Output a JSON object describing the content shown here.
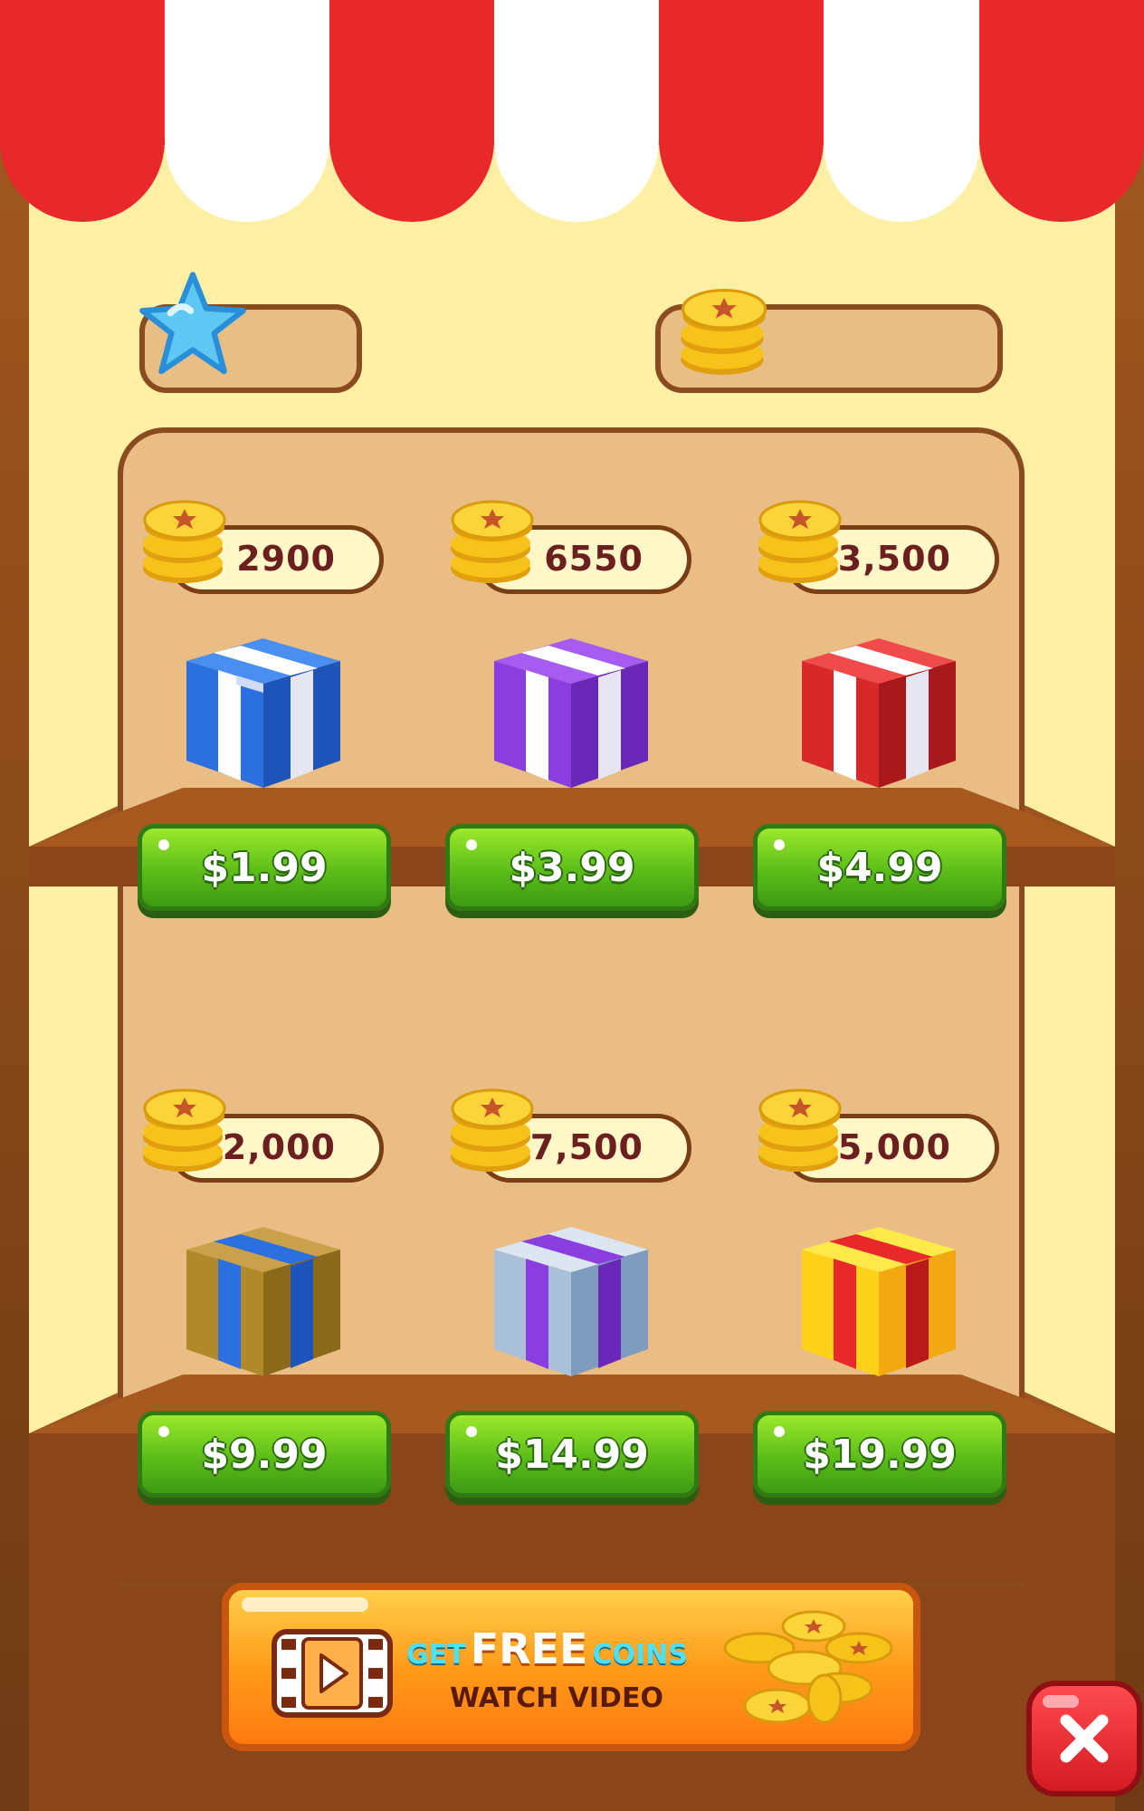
{
  "resources": {
    "stars_value": "",
    "coins_value": ""
  },
  "packs": [
    {
      "coins": "2900",
      "price": "$1.99",
      "box_color": "blue"
    },
    {
      "coins": "6550",
      "price": "$3.99",
      "box_color": "purple"
    },
    {
      "coins": "13,500",
      "price": "$4.99",
      "box_color": "red"
    },
    {
      "coins": "22,000",
      "price": "$9.99",
      "box_color": "gold-blue"
    },
    {
      "coins": "37,500",
      "price": "$14.99",
      "box_color": "silver-purple"
    },
    {
      "coins": "55,000",
      "price": "$19.99",
      "box_color": "yellow-red"
    }
  ],
  "banner": {
    "get": "GET",
    "free": "FREE",
    "coins": "COINS",
    "watch": "WATCH VIDEO"
  },
  "colors": {
    "awning_red": "#e8282b",
    "wall": "#fdf0a4",
    "cabinet": "#e9bd83",
    "wood": "#a45a22",
    "button_green": "#5cbd19",
    "banner_orange": "#ff9c1a",
    "close_red": "#e8282b",
    "label_text": "#6b1f1f",
    "star_blue": "#5ec8f2",
    "coin_gold": "#f7c21a"
  },
  "icons": {
    "star": "star-icon",
    "coin": "coin-stack-icon",
    "video": "video-play-icon",
    "close": "close-icon",
    "gift": "gift-box-icon"
  }
}
